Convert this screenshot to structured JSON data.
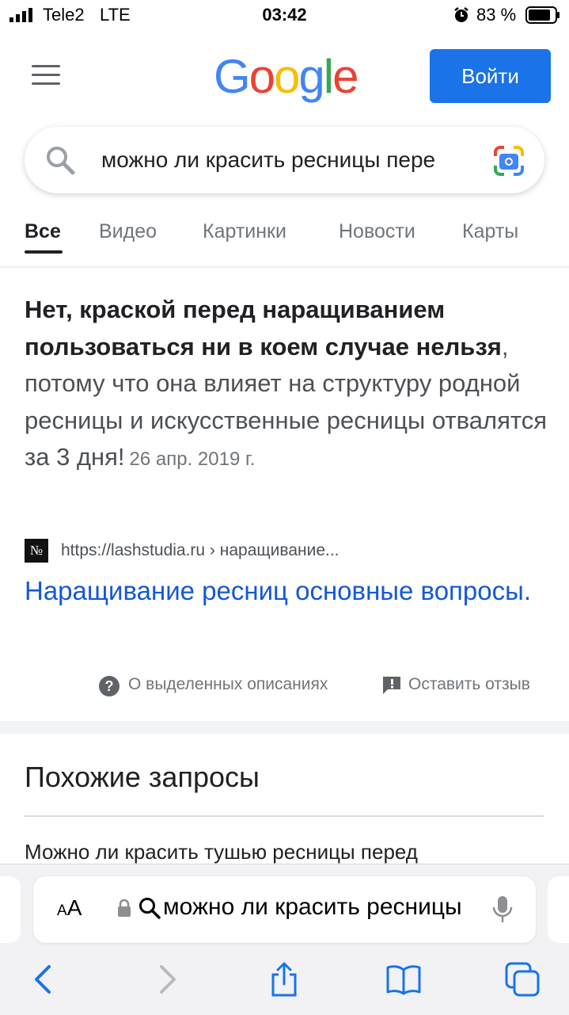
{
  "status_bar": {
    "carrier": "Tele2",
    "network": "LTE",
    "time": "03:42",
    "battery": "83 %",
    "icons": [
      "signal-icon",
      "alarm-icon",
      "battery-icon"
    ]
  },
  "header": {
    "logo": [
      "G",
      "o",
      "o",
      "g",
      "l",
      "e"
    ],
    "logo_colors": [
      "#4285F4",
      "#EA4335",
      "#FBBC05",
      "#4285F4",
      "#34A853",
      "#EA4335"
    ],
    "signin_label": "Войти",
    "accent": "#1a73e8"
  },
  "search": {
    "value": "можно ли красить ресницы пере"
  },
  "tabs": [
    "Все",
    "Видео",
    "Картинки",
    "Новости",
    "Карты"
  ],
  "answer": {
    "bold": "Нет, краской перед наращиванием пользоваться ни в коем случае нельзя",
    "rest": ", потому что она влияет на структуру родной ресницы и искусственные ресницы отвалятся за 3 дня!",
    "date": "26 апр. 2019 г.",
    "favicon": "№",
    "source_url": "https://lashstudia.ru › наращивание...",
    "title": "Наращивание ресниц основные вопросы.",
    "about_label": "О выделенных описаниях",
    "feedback_label": "Оставить отзыв"
  },
  "related": {
    "title": "Похожие запросы",
    "first_item": "Можно ли красить тушью ресницы перед"
  },
  "safari": {
    "aa_label": "AA",
    "address": "можно ли красить ресницы",
    "toolbar_icons": [
      "back-icon",
      "forward-icon",
      "share-icon",
      "bookmarks-icon",
      "tabs-icon"
    ]
  }
}
